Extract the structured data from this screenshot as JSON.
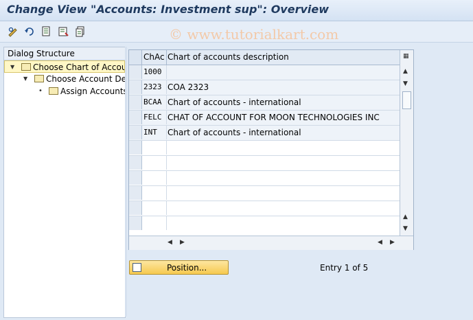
{
  "window": {
    "title": "Change View \"Accounts: Investment sup\": Overview"
  },
  "watermark": "© www.tutorialkart.com",
  "toolbar": {
    "icons": [
      "edit-glasses-icon",
      "undo-icon",
      "details-icon",
      "new-entries-icon",
      "copy-icon"
    ]
  },
  "dialog": {
    "header": "Dialog Structure",
    "items": [
      {
        "label": "Choose Chart of Accoun",
        "selected": true
      },
      {
        "label": "Choose Account Det"
      },
      {
        "label": "Assign Accounts"
      }
    ]
  },
  "table": {
    "columns": [
      "ChAc",
      "Chart of accounts description"
    ],
    "rows": [
      {
        "chac": "1000",
        "desc": ""
      },
      {
        "chac": "2323",
        "desc": "COA 2323"
      },
      {
        "chac": "BCAA",
        "desc": "Chart of accounts - international"
      },
      {
        "chac": "FELC",
        "desc": "CHAT OF ACCOUNT FOR MOON TECHNOLOGIES INC"
      },
      {
        "chac": "INT",
        "desc": "Chart of accounts - international"
      }
    ]
  },
  "position_button": {
    "label": "Position..."
  },
  "entry_info": "Entry 1 of 5"
}
